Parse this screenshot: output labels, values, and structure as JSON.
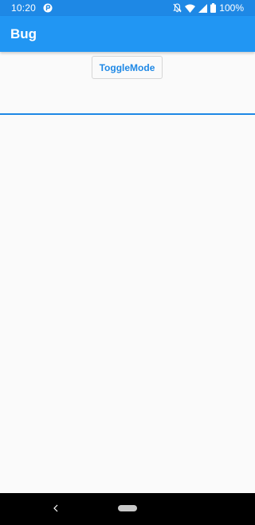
{
  "status_bar": {
    "time": "10:20",
    "battery_percent": "100%",
    "icons": [
      "app-notification-icon",
      "notifications-off-icon",
      "wifi-icon",
      "signal-icon",
      "battery-icon"
    ],
    "background_color": "#1e88e5"
  },
  "app_bar": {
    "title": "Bug",
    "background_color": "#2196f3"
  },
  "main": {
    "toggle_button_label": "ToggleMode",
    "accent_color": "#1e88e5"
  },
  "nav_bar": {
    "icons": [
      "back-icon",
      "home-pill-icon"
    ]
  }
}
